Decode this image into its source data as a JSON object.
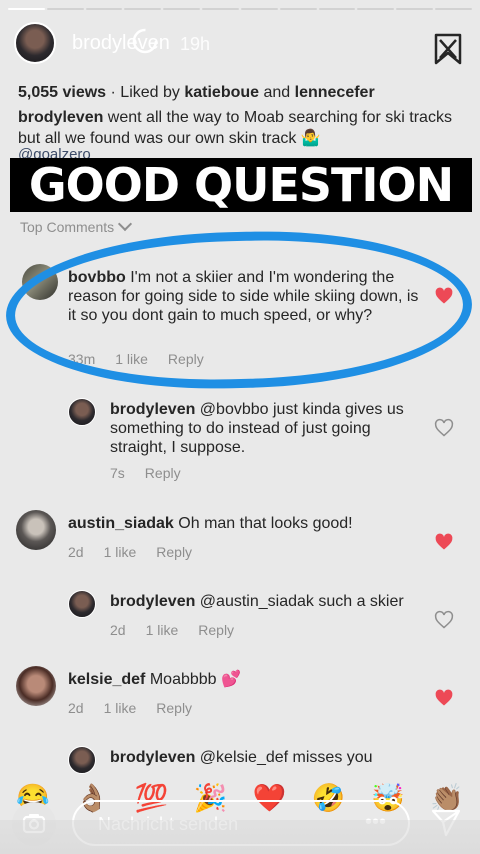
{
  "story": {
    "username": "brodyleven",
    "time_ago": "19h",
    "progress_segments": 12,
    "active_segment": 0
  },
  "post": {
    "views": "5,055 views",
    "liked_by_prefix": " · Liked by ",
    "liked_user_1": "katieboue",
    "liked_and": " and ",
    "liked_user_2": "lennecefer",
    "caption_user": "brodyleven",
    "caption_text": " went all the way to Moab searching for ski tracks but all we found was our own skin track 🤷‍♂️",
    "mention": "@goalzero"
  },
  "banner_text": "GOOD QUESTION",
  "top_comments_label": "Top Comments",
  "comments": [
    {
      "username": "bovbbo",
      "text": " I'm not a skiier and I'm wondering the reason for going side to side while skiing down, is it so you dont gain to much speed, or why?",
      "time": "33m",
      "likes": "1 like",
      "reply": "Reply",
      "liked": true
    },
    {
      "username": "brodyleven",
      "text": " @bovbbo just kinda gives us something to do instead of just going straight, I suppose.",
      "time": "7s",
      "likes": "",
      "reply": "Reply",
      "liked": false
    },
    {
      "username": "austin_siadak",
      "text": " Oh man that looks good!",
      "time": "2d",
      "likes": "1 like",
      "reply": "Reply",
      "liked": true
    },
    {
      "username": "brodyleven",
      "text": " @austin_siadak such a skier",
      "time": "2d",
      "likes": "1 like",
      "reply": "Reply",
      "liked": false
    },
    {
      "username": "kelsie_def",
      "text": " Moabbbb 💕",
      "time": "2d",
      "likes": "1 like",
      "reply": "Reply",
      "liked": true
    },
    {
      "username": "brodyleven",
      "text": " @kelsie_def misses you",
      "time": "",
      "likes": "",
      "reply": "",
      "liked": false
    }
  ],
  "quick_reactions": [
    "😂",
    "👌🏽",
    "💯",
    "🎉",
    "❤️",
    "🤣",
    "🤯",
    "👏🏽"
  ],
  "message_placeholder": "Nachricht senden",
  "more_label": "•••",
  "colors": {
    "highlight_circle": "#1f8fe4",
    "heart_liked": "#ed4956",
    "heart_empty": "#8e8e8e"
  }
}
